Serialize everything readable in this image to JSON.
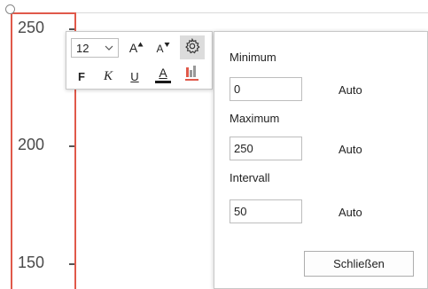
{
  "axis": {
    "tick_labels": [
      "250",
      "200",
      "150"
    ],
    "frame_color": "#e0594a"
  },
  "toolbar": {
    "font_size": "12",
    "grow_font_label": "A",
    "shrink_font_label": "A",
    "bold_label": "F",
    "italic_label": "K",
    "underline_label": "U",
    "font_color_label": "A",
    "font_color_swatch": "#1a1a1a",
    "highlight_swatch": "#e0594a",
    "icons": [
      "chevron-down-icon",
      "grow-font-icon",
      "shrink-font-icon",
      "gear-icon",
      "font-color-icon",
      "chart-fill-icon"
    ]
  },
  "panel": {
    "minimum": {
      "label": "Minimum",
      "value": "0",
      "auto_label": "Auto"
    },
    "maximum": {
      "label": "Maximum",
      "value": "250",
      "auto_label": "Auto"
    },
    "interval": {
      "label": "Intervall",
      "value": "50",
      "auto_label": "Auto"
    },
    "close_label": "Schließen"
  }
}
